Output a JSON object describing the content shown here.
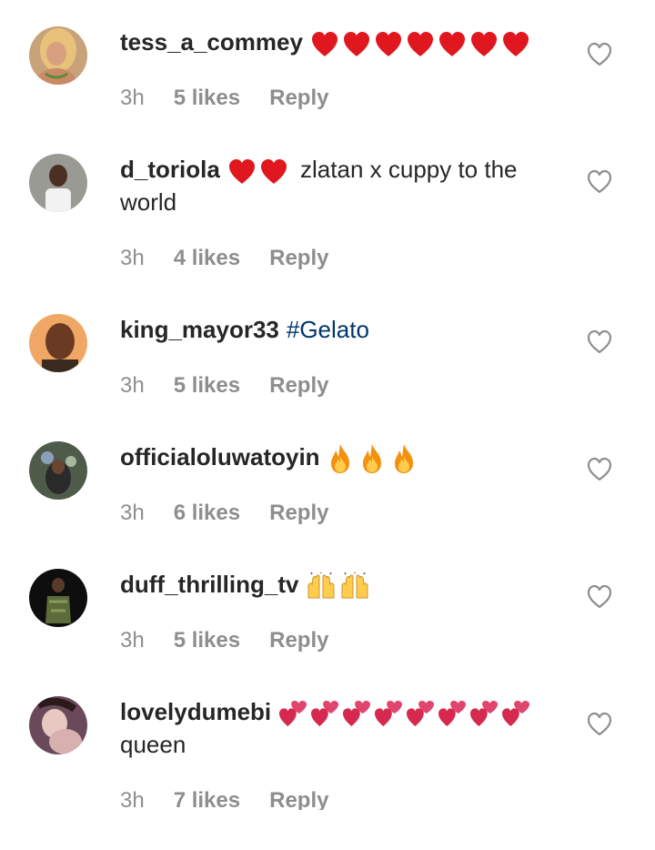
{
  "comments": [
    {
      "username": "tess_a_commey",
      "text": "",
      "time": "3h",
      "likes": "5 likes",
      "reply": "Reply",
      "emoji": "red-heart",
      "emoji_count": 7
    },
    {
      "username": "d_toriola",
      "text": "zlatan x cuppy to the world",
      "time": "3h",
      "likes": "4 likes",
      "reply": "Reply",
      "emoji": "red-heart",
      "emoji_count": 2
    },
    {
      "username": "king_mayor33",
      "hashtag": "#Gelato",
      "time": "3h",
      "likes": "5 likes",
      "reply": "Reply"
    },
    {
      "username": "officialoluwatoyin",
      "text": "",
      "time": "3h",
      "likes": "6 likes",
      "reply": "Reply",
      "emoji": "fire",
      "emoji_count": 3
    },
    {
      "username": "duff_thrilling_tv",
      "text": "",
      "time": "3h",
      "likes": "5 likes",
      "reply": "Reply",
      "emoji": "raising-hands",
      "emoji_count": 2
    },
    {
      "username": "lovelydumebi",
      "text": "queen",
      "time": "3h",
      "likes": "7 likes",
      "reply": "Reply",
      "emoji": "two-hearts",
      "emoji_count": 8
    }
  ],
  "colors": {
    "text": "#262626",
    "meta": "#8e8e8e",
    "hashtag": "#00376b",
    "heart_emoji": "#e0171f"
  },
  "icons": {
    "like": "heart-outline-icon"
  }
}
